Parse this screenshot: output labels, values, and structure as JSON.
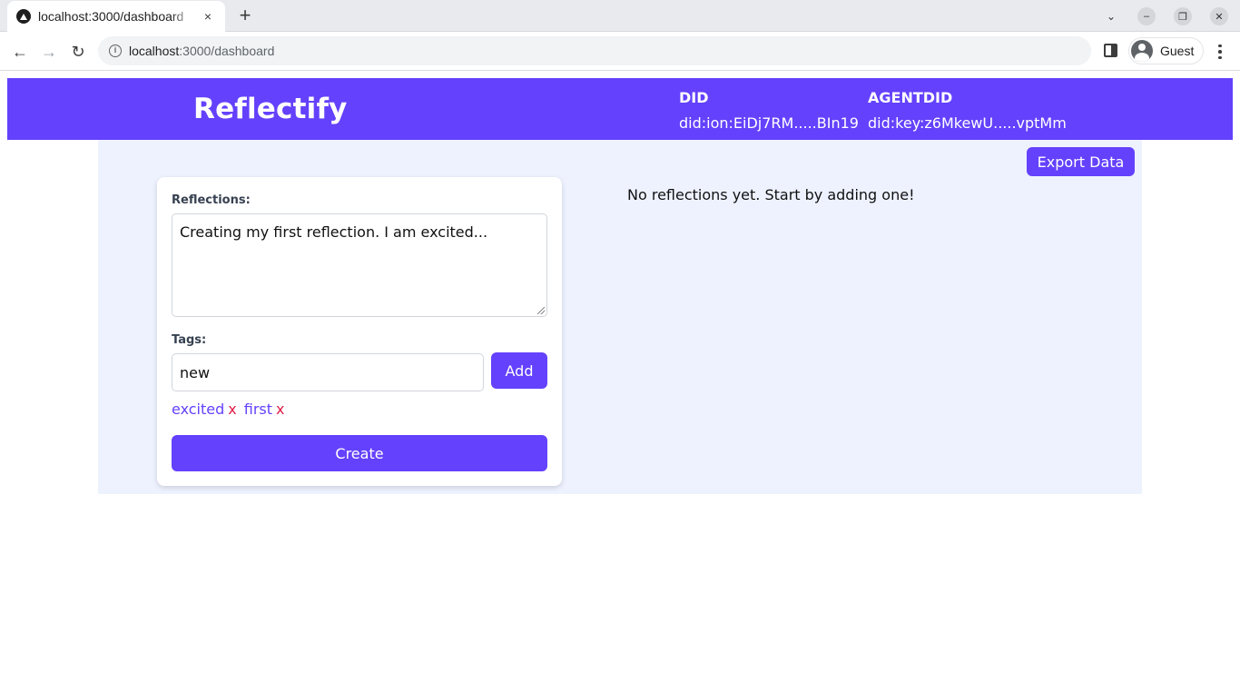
{
  "browser": {
    "tab_title": "localhost:3000/dashboard",
    "tab_close": "×",
    "new_tab": "+",
    "url_host": "localhost",
    "url_path": ":3000/dashboard",
    "profile_label": "Guest",
    "tab_list_icon": "⌄",
    "window_controls": {
      "minimize": "–",
      "restore": "❐",
      "close": "✕"
    },
    "nav": {
      "back": "←",
      "forward": "→",
      "reload": "↻"
    }
  },
  "header": {
    "brand": "Reflectify",
    "did_label": "DID",
    "did_value": "did:ion:EiDj7RM.....BIn19",
    "agent_did_label": "AGENTDID",
    "agent_did_value": "did:key:z6MkewU.....vptMm"
  },
  "main": {
    "export_label": "Export Data",
    "empty_message": "No reflections yet. Start by adding one!"
  },
  "form": {
    "reflections_label": "Reflections:",
    "reflection_text": "Creating my first reflection. I am excited...",
    "tags_label": "Tags:",
    "tag_input_value": "new",
    "add_label": "Add",
    "tags": [
      {
        "name": "excited",
        "remove": "x"
      },
      {
        "name": "first",
        "remove": "x"
      }
    ],
    "create_label": "Create"
  },
  "colors": {
    "brand_purple": "#6441fc",
    "page_bg": "#eef2ff",
    "remove_red": "#e11d48"
  }
}
